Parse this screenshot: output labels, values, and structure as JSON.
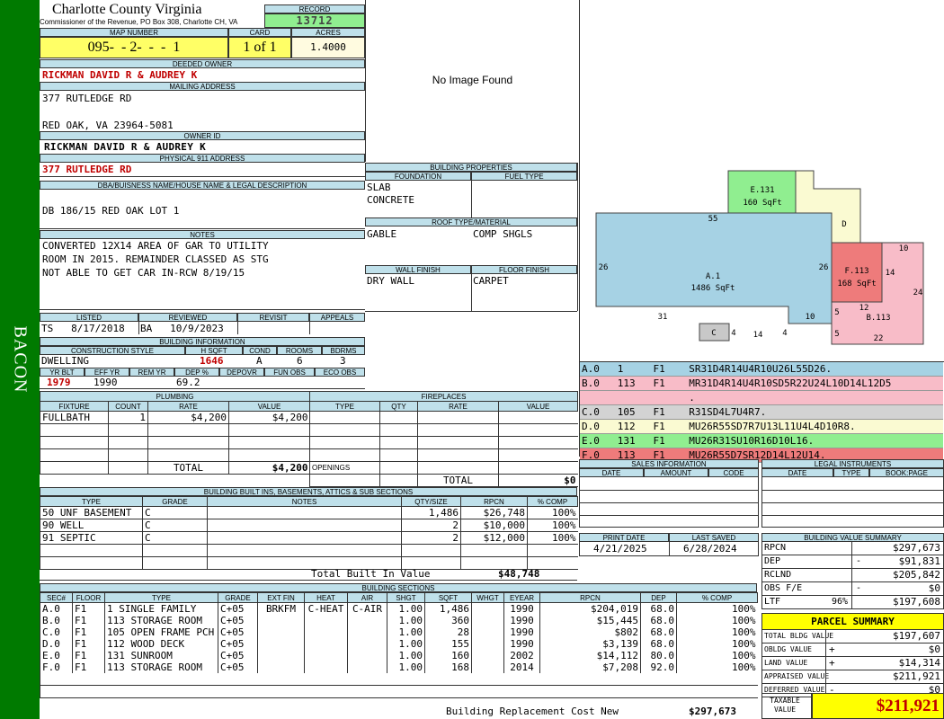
{
  "sidebar": {
    "label": "BACON",
    "color": "#007a00"
  },
  "header": {
    "county": "Charlotte County Virginia",
    "office": "Commissioner of the Revenue, PO Box 308, Charlotte CH, VA",
    "record_label": "RECORD",
    "record": "13712",
    "map_label": "MAP NUMBER",
    "map": "095-  - 2-  -  -  1",
    "card_label": "CARD",
    "card": "1 of 1",
    "acres_label": "ACRES",
    "acres": "1.4000"
  },
  "owner": {
    "deeded_label": "DEEDED OWNER",
    "deeded": "RICKMAN DAVID R & AUDREY K",
    "mailing_label": "MAILING ADDRESS",
    "addr1": "377 RUTLEDGE RD",
    "addr2": "",
    "addr3": "RED OAK, VA 23964-5081",
    "ownerid_label": "OWNER ID",
    "ownerid": "RICKMAN DAVID R & AUDREY K",
    "phys_label": "PHYSICAL 911 ADDRESS",
    "phys": "377 RUTLEDGE RD",
    "dba_label": "DBA/BUISNESS NAME/HOUSE NAME & LEGAL DESCRIPTION",
    "dba": "DB 186/15 RED OAK LOT 1"
  },
  "notes": {
    "label": "NOTES",
    "line1": "CONVERTED 12X14 AREA OF GAR TO UTILITY",
    "line2": "ROOM IN 2015. REMAINDER CLASSED AS STG",
    "line3": "NOT ABLE TO GET CAR IN-RCW 8/19/15"
  },
  "review": {
    "listed_label": "LISTED",
    "listed": "TS   8/17/2018",
    "reviewed_label": "REVIEWED",
    "reviewed": "BA   10/9/2023",
    "revisit_label": "REVISIT",
    "appeals_label": "APPEALS"
  },
  "building_info": {
    "label": "BUILDING INFORMATION",
    "style_label": "CONSTRUCTION STYLE",
    "style": "DWELLING",
    "hsqft_label": "H SQFT",
    "hsqft": "1646",
    "cond_label": "COND",
    "cond": "A",
    "rooms_label": "ROOMS",
    "rooms": "6",
    "bdrms_label": "BDRMS",
    "bdrms": "3",
    "yrblt_label": "YR BLT",
    "yrblt": "1979",
    "effyr_label": "EFF YR",
    "effyr": "1990",
    "remyr_label": "REM YR",
    "remyr": "",
    "dep_label": "DEP %",
    "dep": "69.2",
    "depovr_label": "DEPOVR",
    "funobs_label": "FUN OBS",
    "ecoobs_label": "ECO OBS"
  },
  "image": {
    "text": "No Image Found"
  },
  "props": {
    "label": "BUILDING PROPERTIES",
    "foundation_label": "FOUNDATION",
    "fuel_label": "FUEL TYPE",
    "foundation1": "SLAB",
    "foundation2": "CONCRETE",
    "roof_label": "ROOF TYPE/MATERIAL",
    "roof1": "GABLE",
    "roof2": "COMP SHGLS",
    "wall_label": "WALL FINISH",
    "floor_label": "FLOOR FINISH",
    "wall": "DRY WALL",
    "floor": "CARPET"
  },
  "sketch": {
    "a_label": "A.1",
    "a_area": "1486 SqFt",
    "b_label": "B.113",
    "e_label": "E.131",
    "e_area": "160 SqFt",
    "f_label": "F.113",
    "f_area": "168 SqFt",
    "c_label": "C",
    "d_label": "D",
    "dims": [
      "55",
      "26",
      "26",
      "31",
      "10",
      "4",
      "14",
      "4",
      "10",
      "14",
      "24",
      "5",
      "12",
      "5",
      "22"
    ],
    "colors": {
      "a": "#a6d2e4",
      "b": "#f8bcc8",
      "c": "#c8c8c8",
      "d": "#fafad2",
      "e": "#90ee90",
      "f": "#ee7b7b"
    }
  },
  "vectors": [
    {
      "text": "A.0   1     F1    SR31D4R14U4R10U26L55D26.",
      "color": "#a6d2e4"
    },
    {
      "text": "B.0   113   F1    MR31D4R14U4R10SD5R22U24L10D14L12D5",
      "color": "#f8bcc8"
    },
    {
      "text": "                  .",
      "color": "#f8bcc8"
    },
    {
      "text": "C.0   105   F1    R31SD4L7U4R7.",
      "color": "#d3d3d3"
    },
    {
      "text": "D.0   112   F1    MU26R55SD7R7U13L11U4L4D10R8.",
      "color": "#fafad2"
    },
    {
      "text": "E.0   131   F1    MU26R31SU10R16D10L16.",
      "color": "#90ee90"
    },
    {
      "text": "F.0   113   F1    MU26R55D7SR12D14L12U14.",
      "color": "#ee7b7b"
    }
  ],
  "plumbing": {
    "label": "PLUMBING",
    "cols": [
      "FIXTURE",
      "COUNT",
      "RATE",
      "VALUE"
    ],
    "rows": [
      [
        "FULLBATH",
        "1",
        "$4,200",
        "$4,200"
      ]
    ],
    "total_label": "TOTAL",
    "total": "$4,200"
  },
  "fireplaces": {
    "label": "FIREPLACES",
    "cols": [
      "TYPE",
      "QTY",
      "RATE",
      "VALUE"
    ],
    "openings_label": "OPENINGS",
    "total_label": "TOTAL",
    "total": "$0"
  },
  "sales": {
    "label": "SALES INFORMATION",
    "cols": [
      "DATE",
      "AMOUNT",
      "CODE"
    ]
  },
  "legal": {
    "label": "LEGAL INSTRUMENTS",
    "cols": [
      "DATE",
      "TYPE",
      "BOOK:PAGE"
    ]
  },
  "builtins": {
    "label": "BUILDING BUILT INS, BASEMENTS, ATTICS & SUB SECTIONS",
    "cols": [
      "TYPE",
      "GRADE",
      "NOTES",
      "QTY/SIZE",
      "RPCN",
      "% COMP"
    ],
    "rows": [
      [
        "50 UNF BASEMENT",
        "C",
        "",
        "1,486",
        "$26,748",
        "100%"
      ],
      [
        "90 WELL",
        "C",
        "",
        "2",
        "$10,000",
        "100%"
      ],
      [
        "91 SEPTIC",
        "C",
        "",
        "2",
        "$12,000",
        "100%"
      ]
    ],
    "total_label": "Total Built In Value",
    "total": "$48,748"
  },
  "dates": {
    "print_label": "PRINT DATE",
    "print": "4/21/2025",
    "saved_label": "LAST SAVED",
    "saved": "6/28/2024"
  },
  "bvs": {
    "label": "BUILDING VALUE SUMMARY",
    "rows": [
      {
        "k": "RPCN",
        "s": "",
        "v": "$297,673"
      },
      {
        "k": "DEP",
        "s": "-",
        "v": "$91,831"
      },
      {
        "k": "RCLND",
        "s": "",
        "v": "$205,842"
      },
      {
        "k": "OBS F/E",
        "s": "-",
        "v": "$0"
      },
      {
        "k": "LTF",
        "p": "96%",
        "s": "",
        "v": "$197,608"
      }
    ]
  },
  "sections": {
    "label": "BUILDING SECTIONS",
    "cols": [
      "SEC#",
      "FLOOR",
      "TYPE",
      "GRADE",
      "EXT FIN",
      "HEAT",
      "AIR",
      "SHGT",
      "SQFT",
      "WHGT",
      "EYEAR",
      "RPCN",
      "DEP",
      "% COMP"
    ],
    "rows": [
      [
        "A.0",
        "F1",
        "1 SINGLE FAMILY",
        "C+05",
        "BRKFM",
        "C-HEAT",
        "C-AIR",
        "1.00",
        "1,486",
        "",
        "1990",
        "$204,019",
        "68.0",
        "100%"
      ],
      [
        "B.0",
        "F1",
        "113 STORAGE ROOM",
        "C+05",
        "",
        "",
        "",
        "1.00",
        "360",
        "",
        "1990",
        "$15,445",
        "68.0",
        "100%"
      ],
      [
        "C.0",
        "F1",
        "105 OPEN FRAME PCH",
        "C+05",
        "",
        "",
        "",
        "1.00",
        "28",
        "",
        "1990",
        "$802",
        "68.0",
        "100%"
      ],
      [
        "D.0",
        "F1",
        "112 WOOD DECK",
        "C+05",
        "",
        "",
        "",
        "1.00",
        "155",
        "",
        "1990",
        "$3,139",
        "68.0",
        "100%"
      ],
      [
        "E.0",
        "F1",
        "131 SUNROOM",
        "C+05",
        "",
        "",
        "",
        "1.00",
        "160",
        "",
        "2002",
        "$14,112",
        "80.0",
        "100%"
      ],
      [
        "F.0",
        "F1",
        "113 STORAGE ROOM",
        "C+05",
        "",
        "",
        "",
        "1.00",
        "168",
        "",
        "2014",
        "$7,208",
        "92.0",
        "100%"
      ]
    ],
    "total_label": "Building Replacement Cost New",
    "total": "$297,673"
  },
  "parcel": {
    "label": "PARCEL SUMMARY",
    "rows": [
      {
        "k": "TOTAL BLDG VALUE",
        "s": "",
        "v": "$197,607"
      },
      {
        "k": "OBLDG VALUE",
        "s": "+",
        "v": "$0"
      },
      {
        "k": "LAND VALUE",
        "s": "+",
        "v": "$14,314"
      },
      {
        "k": "APPRAISED VALUE",
        "s": "",
        "v": "$211,921"
      },
      {
        "k": "DEFERRED VALUE",
        "s": "-",
        "v": "$0"
      }
    ],
    "taxable_label": "TAXABLE VALUE",
    "taxable": "$211,921",
    "highlight": "#ffff00"
  }
}
